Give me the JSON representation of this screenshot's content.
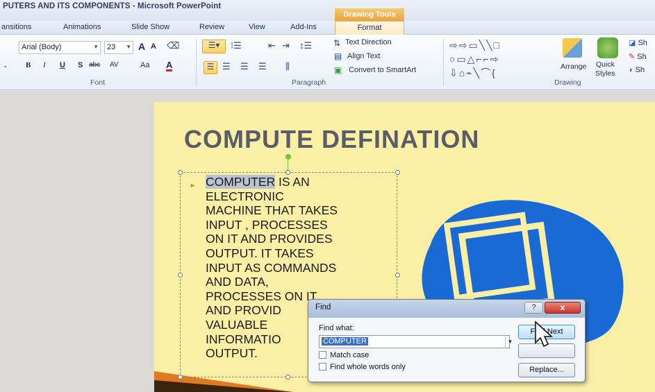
{
  "window": {
    "title": "PUTERS AND ITS COMPONENTS - Microsoft PowerPoint",
    "contextual_tab_group": "Drawing Tools"
  },
  "tabs": [
    "ansitions",
    "Animations",
    "Slide Show",
    "Review",
    "View",
    "Add-Ins",
    "Format"
  ],
  "ribbon": {
    "font": {
      "font_name": "Arial (Body)",
      "font_size": "23",
      "grow_font": "A",
      "shrink_font": "A",
      "change_case": "Aa",
      "group_label": "Font"
    },
    "paragraph": {
      "text_direction": "Text Direction",
      "align_text": "Align Text",
      "convert_smartart": "Convert to SmartArt",
      "group_label": "Paragraph"
    },
    "drawing": {
      "arrange": "Arrange",
      "quick_styles_1": "Quick",
      "quick_styles_2": "Styles",
      "shape_fill": "Sh",
      "shape_outline": "Sh",
      "shape_effects": "Sh",
      "group_label": "Drawing"
    }
  },
  "slide": {
    "title": "COMPUTE DEFINATION",
    "highlighted_word": "COMPUTER",
    "first_line_rest": " IS AN",
    "lines": [
      "ELECTRONIC",
      "MACHINE THAT TAKES",
      "INPUT , PROCESSES",
      "ON IT AND PROVIDES",
      "OUTPUT. IT TAKES",
      "INPUT AS COMMANDS",
      "AND DATA,",
      "PROCESSES ON IT",
      "AND PROVID",
      "VALUABLE",
      "INFORMATIO",
      "OUTPUT."
    ]
  },
  "find_dialog": {
    "title": "Find",
    "help": "?",
    "close": "x",
    "find_what_label": "Find what:",
    "find_what_value": "COMPUTER",
    "match_case": "Match case",
    "whole_words": "Find whole words only",
    "find_next": "Find Next",
    "replace": "Replace..."
  },
  "colors": {
    "slide_bg": "#fbefa6",
    "title_text": "#5a5d68",
    "computer_blue": "#1a6ad6",
    "accent_orange": "#e07a20"
  }
}
